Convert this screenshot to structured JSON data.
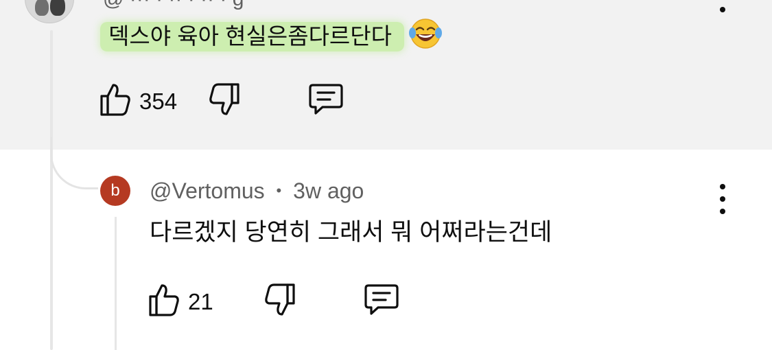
{
  "top_comment": {
    "header_partial": "@ ··· · ·· ·  ·· · g",
    "text": "덱스야 육아 현실은좀다르단다",
    "emoji": "face-with-tears-of-joy",
    "highlight_color": "#cdeeb0",
    "like_count": "354"
  },
  "reply": {
    "avatar_letter": "b",
    "avatar_color": "#b53a22",
    "author": "@Vertomus",
    "separator": "•",
    "time": "3w ago",
    "text": "다르겠지 당연히 그래서 뭐 어쩌라는건데",
    "like_count": "21"
  },
  "icons": {
    "like": "thumbs-up-icon",
    "dislike": "thumbs-down-icon",
    "reply": "comment-icon",
    "more": "more-vertical-icon"
  }
}
